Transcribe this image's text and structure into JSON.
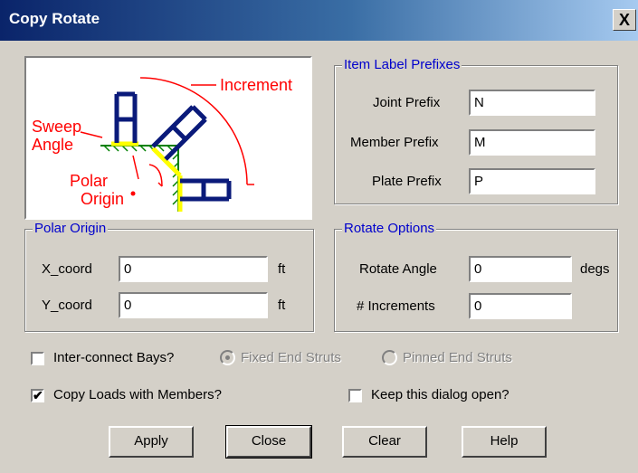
{
  "window": {
    "title": "Copy Rotate",
    "close_glyph": "X"
  },
  "preview": {
    "label_increment": "Increment",
    "label_sweep": "Sweep",
    "label_angle": "Angle",
    "label_polar": "Polar",
    "label_origin": "Origin"
  },
  "polar_origin": {
    "legend": "Polar Origin",
    "x_label": "X_coord",
    "x_value": "0",
    "x_unit": "ft",
    "y_label": "Y_coord",
    "y_value": "0",
    "y_unit": "ft"
  },
  "item_label_prefixes": {
    "legend": "Item Label Prefixes",
    "joint_label": "Joint Prefix",
    "joint_value": "N",
    "member_label": "Member Prefix",
    "member_value": "M",
    "plate_label": "Plate Prefix",
    "plate_value": "P"
  },
  "rotate_options": {
    "legend": "Rotate Options",
    "angle_label": "Rotate Angle",
    "angle_value": "0",
    "angle_unit": "degs",
    "increments_label": "# Increments",
    "increments_value": "0"
  },
  "options": {
    "interconnect_label": "Inter-connect Bays?",
    "interconnect_checked": false,
    "fixed_label": "Fixed End Struts",
    "pinned_label": "Pinned End Struts",
    "copy_loads_label": "Copy Loads with Members?",
    "copy_loads_checked": true,
    "keep_open_label": "Keep this dialog open?",
    "keep_open_checked": false,
    "check_glyph": "✔"
  },
  "buttons": {
    "apply": "Apply",
    "close": "Close",
    "clear": "Clear",
    "help": "Help"
  },
  "colors": {
    "title_start": "#0a246a",
    "legend_text": "#0000cc",
    "annotation": "#ff0000",
    "structure": "#0a1a7a",
    "highlight": "#ffff00",
    "hatch": "#008000"
  }
}
